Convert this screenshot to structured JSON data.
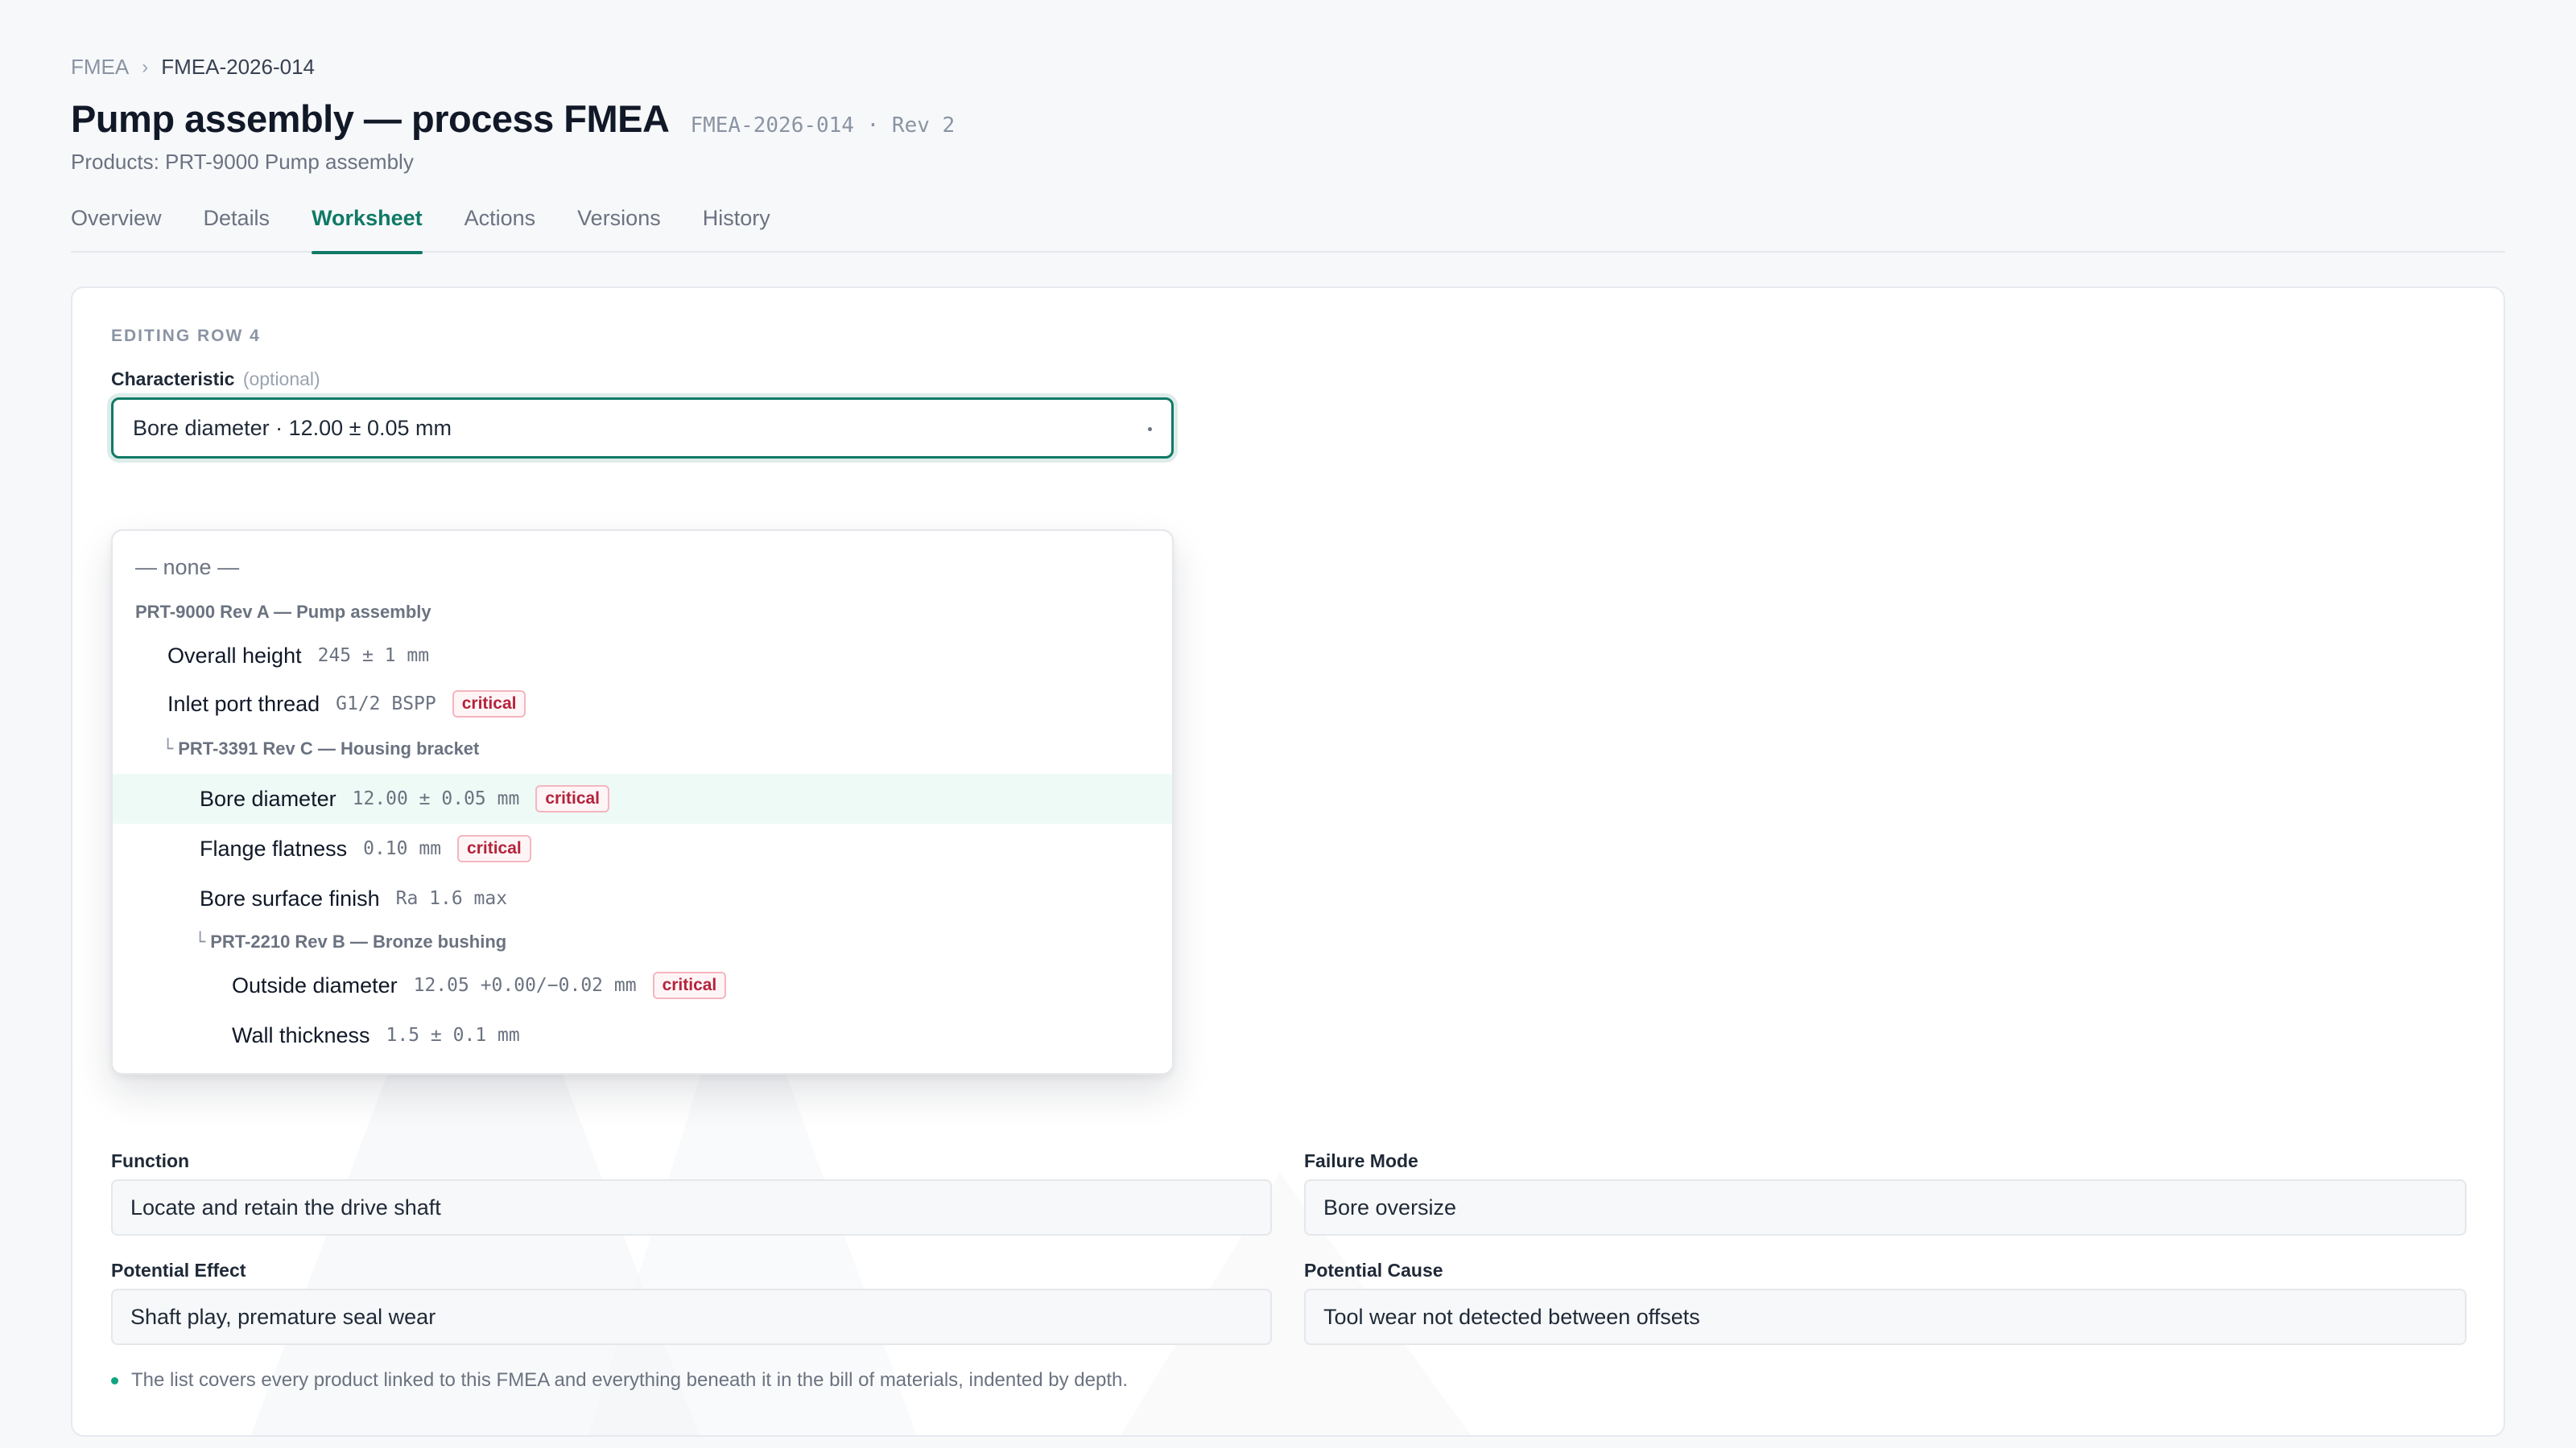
{
  "breadcrumb": {
    "root": "FMEA",
    "separator": "›",
    "current": "FMEA-2026-014"
  },
  "header": {
    "title": "Pump assembly — process FMEA",
    "meta": "FMEA-2026-014 · Rev 2",
    "products": "Products: PRT-9000 Pump assembly"
  },
  "tabs": [
    {
      "label": "Overview",
      "active": false
    },
    {
      "label": "Details",
      "active": false
    },
    {
      "label": "Worksheet",
      "active": true
    },
    {
      "label": "Actions",
      "active": false
    },
    {
      "label": "Versions",
      "active": false
    },
    {
      "label": "History",
      "active": false
    }
  ],
  "editor": {
    "section_label": "EDITING ROW 4",
    "characteristic": {
      "label": "Characteristic",
      "optional": "(optional)",
      "value": "Bore diameter · 12.00 ± 0.05 mm"
    },
    "dropdown": {
      "none_label": "— none —",
      "groups": [
        {
          "tree": "",
          "label": "PRT-9000 Rev A — Pump assembly"
        },
        {
          "tree": "└",
          "label": "PRT-3391 Rev C — Housing bracket"
        },
        {
          "tree": "└",
          "label": "PRT-2210 Rev B — Bronze bushing"
        }
      ],
      "options": [
        {
          "name": "Overall height",
          "spec": "245 ± 1 mm",
          "badge": ""
        },
        {
          "name": "Inlet port thread",
          "spec": "G1/2 BSPP",
          "badge": "critical"
        },
        {
          "name": "Bore diameter",
          "spec": "12.00 ± 0.05 mm",
          "badge": "critical",
          "highlighted": true
        },
        {
          "name": "Flange flatness",
          "spec": "0.10 mm",
          "badge": "critical"
        },
        {
          "name": "Bore surface finish",
          "spec": "Ra 1.6 max",
          "badge": ""
        },
        {
          "name": "Outside diameter",
          "spec": "12.05 +0.00/−0.02 mm",
          "badge": "critical"
        },
        {
          "name": "Wall thickness",
          "spec": "1.5 ± 0.1 mm",
          "badge": ""
        }
      ]
    },
    "fields": {
      "function": {
        "label": "Function",
        "value": "Locate and retain the drive shaft"
      },
      "failure_mode": {
        "label": "Failure Mode",
        "value": "Bore oversize"
      },
      "potential_effect": {
        "label": "Potential Effect",
        "value": "Shaft play, premature seal wear"
      },
      "potential_cause": {
        "label": "Potential Cause",
        "value": "Tool wear not detected between offsets"
      }
    },
    "hint": "The list covers every product linked to this FMEA and everything beneath it in the bill of materials, indented by depth."
  },
  "colors": {
    "accent": "#0f7a66",
    "critical": "#b4233c",
    "highlight_row": "#eefaf6"
  }
}
